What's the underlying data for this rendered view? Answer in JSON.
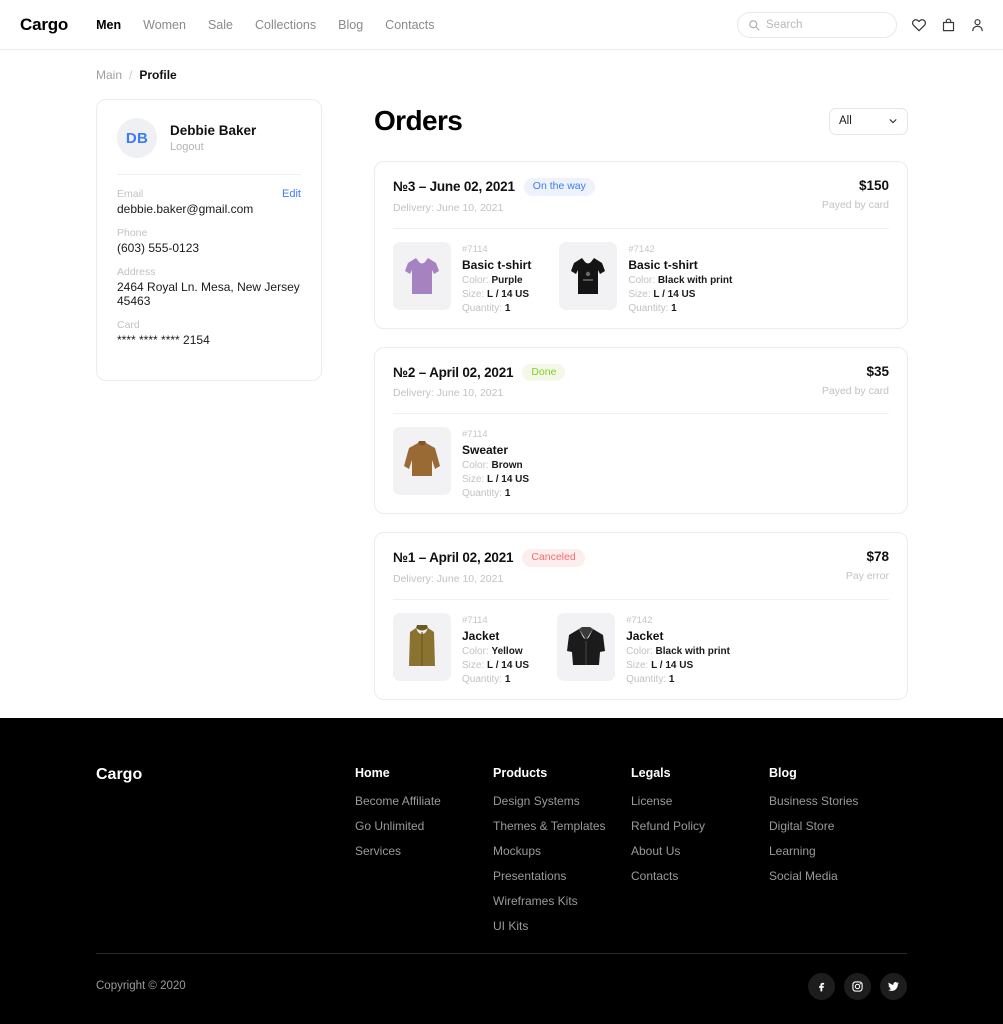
{
  "header": {
    "brand": "Cargo",
    "nav": [
      {
        "label": "Men",
        "active": true
      },
      {
        "label": "Women",
        "active": false
      },
      {
        "label": "Sale",
        "active": false
      },
      {
        "label": "Collections",
        "active": false
      },
      {
        "label": "Blog",
        "active": false
      },
      {
        "label": "Contacts",
        "active": false
      }
    ],
    "search": {
      "value": "",
      "placeholder": "Search",
      "icon": "search-icon"
    },
    "icons": [
      "heart-icon",
      "bag-icon",
      "user-icon"
    ]
  },
  "breadcrumb": {
    "root": "Main",
    "separator": "/",
    "current": "Profile"
  },
  "profile": {
    "avatar_initials": "DB",
    "name": "Debbie Baker",
    "logout_label": "Logout",
    "edit_label": "Edit",
    "fields": [
      {
        "label": "Email",
        "value": "debbie.baker@gmail.com"
      },
      {
        "label": "Phone",
        "value": "(603) 555-0123"
      },
      {
        "label": "Address",
        "value": "2464 Royal Ln. Mesa, New Jersey 45463"
      },
      {
        "label": "Card",
        "value": "**** **** **** 2154"
      }
    ]
  },
  "orders_section": {
    "title": "Orders",
    "filter": {
      "selected": "All",
      "icon": "chevron-down-icon"
    },
    "orders": [
      {
        "number": "№3 – June 02, 2021",
        "status": {
          "label": "On the way",
          "kind": "onway"
        },
        "delivery": "Delivery: June 10, 2021",
        "price": "$150",
        "payment": "Payed by card",
        "items": [
          {
            "sku": "#7114",
            "name": "Basic t-shirt",
            "color_label": "Color:",
            "color": "Purple",
            "size_label": "Size:",
            "size": "L / 14 US",
            "qty_label": "Quantity:",
            "qty": "1",
            "image": "tshirt-purple"
          },
          {
            "sku": "#7142",
            "name": "Basic t-shirt",
            "color_label": "Color:",
            "color": "Black with print",
            "size_label": "Size:",
            "size": "L / 14 US",
            "qty_label": "Quantity:",
            "qty": "1",
            "image": "tshirt-black"
          }
        ]
      },
      {
        "number": "№2 – April 02, 2021",
        "status": {
          "label": "Done",
          "kind": "done"
        },
        "delivery": "Delivery: June 10, 2021",
        "price": "$35",
        "payment": "Payed by card",
        "items": [
          {
            "sku": "#7114",
            "name": "Sweater",
            "color_label": "Color:",
            "color": "Brown",
            "size_label": "Size:",
            "size": "L / 14 US",
            "qty_label": "Quantity:",
            "qty": "1",
            "image": "sweater-brown"
          }
        ]
      },
      {
        "number": "№1 – April 02, 2021",
        "status": {
          "label": "Canceled",
          "kind": "cancel"
        },
        "delivery": "Delivery: June 10, 2021",
        "price": "$78",
        "payment": "Pay error",
        "items": [
          {
            "sku": "#7114",
            "name": "Jacket",
            "color_label": "Color:",
            "color": "Yellow",
            "size_label": "Size:",
            "size": "L / 14 US",
            "qty_label": "Quantity:",
            "qty": "1",
            "image": "jacket-yellow"
          },
          {
            "sku": "#7142",
            "name": "Jacket",
            "color_label": "Color:",
            "color": "Black with print",
            "size_label": "Size:",
            "size": "L / 14 US",
            "qty_label": "Quantity:",
            "qty": "1",
            "image": "jacket-black"
          }
        ]
      }
    ]
  },
  "footer": {
    "brand": "Cargo",
    "columns": [
      {
        "head": "Home",
        "links": [
          "Become Affiliate",
          "Go Unlimited",
          "Services"
        ]
      },
      {
        "head": "Products",
        "links": [
          "Design Systems",
          "Themes & Templates",
          "Mockups",
          "Presentations",
          "Wireframes Kits",
          "UI Kits"
        ]
      },
      {
        "head": "Legals",
        "links": [
          "License",
          "Refund Policy",
          "About Us",
          "Contacts"
        ]
      },
      {
        "head": "Blog",
        "links": [
          "Business Stories",
          "Digital Store",
          "Learning",
          "Social Media"
        ]
      }
    ],
    "copyright": "Copyright © 2020",
    "socials": [
      "facebook-icon",
      "instagram-icon",
      "twitter-icon"
    ]
  },
  "colors": {
    "accent_blue": "#3b7cf6",
    "status_onway": "#3b7cf6",
    "status_done": "#7ed321",
    "status_cancel": "#ff6a6a",
    "footer_bg": "#000000",
    "text_muted": "#c2c2c6"
  }
}
